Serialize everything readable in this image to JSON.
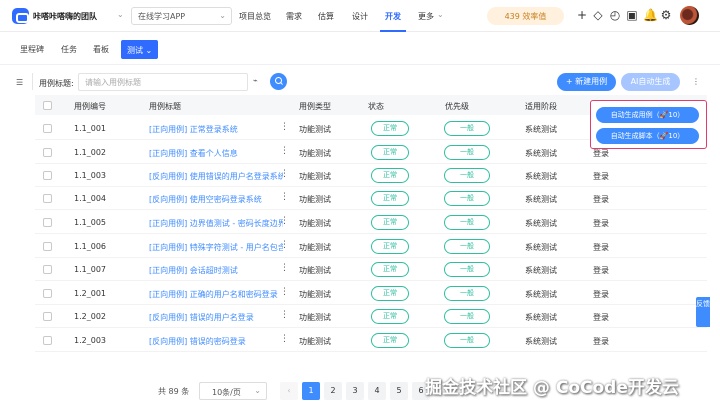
{
  "header": {
    "team": "咔嗒咔嗒嗨的团队",
    "project": "在线学习APP",
    "points": "439 效率值",
    "nav": [
      "项目总览",
      "需求",
      "估算",
      "设计",
      "开发",
      "更多"
    ]
  },
  "subtabs": [
    "里程碑",
    "任务",
    "看板",
    "测试"
  ],
  "toolbar": {
    "field_label": "用例标题:",
    "placeholder": "请输入用例标题",
    "new_label": "+ 新建用例",
    "ai_label": "AI自动生成"
  },
  "columns": [
    "用例编号",
    "用例标题",
    "用例类型",
    "状态",
    "优先级",
    "适用阶段"
  ],
  "rows": [
    {
      "id": "1.1_001",
      "title": "[正向用例] 正常登录系统",
      "type": "功能测试",
      "status": "正常",
      "priority": "一般",
      "stage": "系统测试",
      "extra": ""
    },
    {
      "id": "1.1_002",
      "title": "[正向用例] 查看个人信息",
      "type": "功能测试",
      "status": "正常",
      "priority": "一般",
      "stage": "系统测试",
      "extra": "登录"
    },
    {
      "id": "1.1_003",
      "title": "[反向用例] 使用错误的用户名登录系统",
      "type": "功能测试",
      "status": "正常",
      "priority": "一般",
      "stage": "系统测试",
      "extra": "登录"
    },
    {
      "id": "1.1_004",
      "title": "[反向用例] 使用空密码登录系统",
      "type": "功能测试",
      "status": "正常",
      "priority": "一般",
      "stage": "系统测试",
      "extra": "登录"
    },
    {
      "id": "1.1_005",
      "title": "[正向用例] 边界值测试 - 密码长度边界值",
      "type": "功能测试",
      "status": "正常",
      "priority": "一般",
      "stage": "系统测试",
      "extra": "登录"
    },
    {
      "id": "1.1_006",
      "title": "[正向用例] 特殊字符测试 - 用户名包含特殊字符",
      "type": "功能测试",
      "status": "正常",
      "priority": "一般",
      "stage": "系统测试",
      "extra": "登录"
    },
    {
      "id": "1.1_007",
      "title": "[正向用例] 会话超时测试",
      "type": "功能测试",
      "status": "正常",
      "priority": "一般",
      "stage": "系统测试",
      "extra": "登录"
    },
    {
      "id": "1.2_001",
      "title": "[正向用例] 正确的用户名和密码登录",
      "type": "功能测试",
      "status": "正常",
      "priority": "一般",
      "stage": "系统测试",
      "extra": "登录"
    },
    {
      "id": "1.2_002",
      "title": "[反向用例] 错误的用户名登录",
      "type": "功能测试",
      "status": "正常",
      "priority": "一般",
      "stage": "系统测试",
      "extra": "登录"
    },
    {
      "id": "1.2_003",
      "title": "[反向用例] 错误的密码登录",
      "type": "功能测试",
      "status": "正常",
      "priority": "一般",
      "stage": "系统测试",
      "extra": "登录"
    }
  ],
  "popup": {
    "gen_cases": "自动生成用例（🚀10）",
    "gen_scripts": "自动生成脚本（🚀10）"
  },
  "feedback": "反馈",
  "pagination": {
    "total": "共 89 条",
    "page_size": "10条/页",
    "pages": [
      "1",
      "2",
      "3",
      "4",
      "5",
      "6"
    ],
    "active": "1"
  },
  "watermark": "掘金技术社区 @ CoCode开发云"
}
